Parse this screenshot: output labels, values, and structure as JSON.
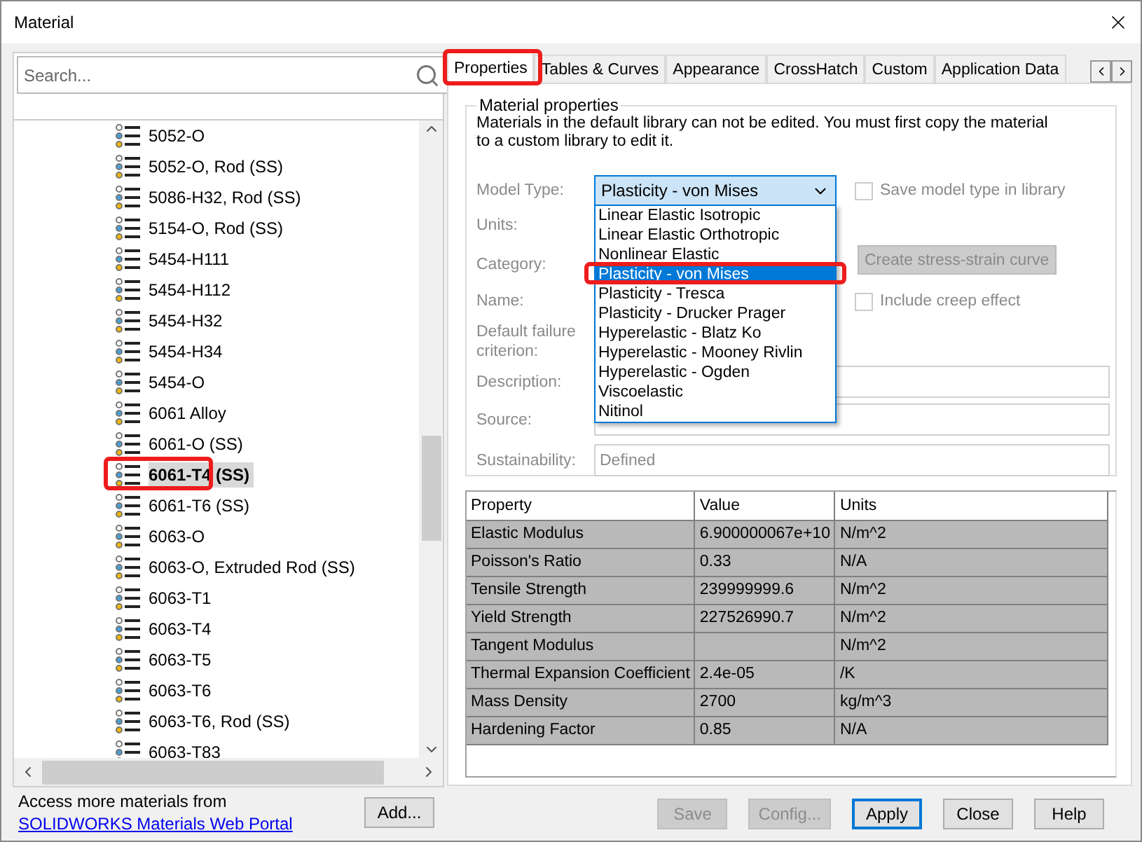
{
  "window": {
    "title": "Material"
  },
  "search": {
    "placeholder": "Search..."
  },
  "tree_items": [
    {
      "label": "5052-O",
      "selected": false,
      "annotated": false
    },
    {
      "label": "5052-O, Rod (SS)",
      "selected": false,
      "annotated": false
    },
    {
      "label": "5086-H32, Rod (SS)",
      "selected": false,
      "annotated": false
    },
    {
      "label": "5154-O, Rod (SS)",
      "selected": false,
      "annotated": false
    },
    {
      "label": "5454-H111",
      "selected": false,
      "annotated": false
    },
    {
      "label": "5454-H112",
      "selected": false,
      "annotated": false
    },
    {
      "label": "5454-H32",
      "selected": false,
      "annotated": false
    },
    {
      "label": "5454-H34",
      "selected": false,
      "annotated": false
    },
    {
      "label": "5454-O",
      "selected": false,
      "annotated": false
    },
    {
      "label": "6061 Alloy",
      "selected": false,
      "annotated": false
    },
    {
      "label": "6061-O (SS)",
      "selected": false,
      "annotated": false
    },
    {
      "label": "6061-T4 (SS)",
      "selected": true,
      "annotated": true
    },
    {
      "label": "6061-T6 (SS)",
      "selected": false,
      "annotated": false
    },
    {
      "label": "6063-O",
      "selected": false,
      "annotated": false
    },
    {
      "label": "6063-O, Extruded Rod (SS)",
      "selected": false,
      "annotated": false
    },
    {
      "label": "6063-T1",
      "selected": false,
      "annotated": false
    },
    {
      "label": "6063-T4",
      "selected": false,
      "annotated": false
    },
    {
      "label": "6063-T5",
      "selected": false,
      "annotated": false
    },
    {
      "label": "6063-T6",
      "selected": false,
      "annotated": false
    },
    {
      "label": "6063-T6, Rod (SS)",
      "selected": false,
      "annotated": false
    },
    {
      "label": "6063-T83",
      "selected": false,
      "annotated": false
    }
  ],
  "footer": {
    "text": "Access more materials from",
    "link": "SOLIDWORKS Materials Web Portal",
    "add_button": "Add..."
  },
  "tabs": [
    {
      "label": "Properties",
      "selected": true,
      "annotated": true
    },
    {
      "label": "Tables & Curves",
      "selected": false,
      "annotated": false
    },
    {
      "label": "Appearance",
      "selected": false,
      "annotated": false
    },
    {
      "label": "CrossHatch",
      "selected": false,
      "annotated": false
    },
    {
      "label": "Custom",
      "selected": false,
      "annotated": false
    },
    {
      "label": "Application Data",
      "selected": false,
      "annotated": false
    }
  ],
  "group": {
    "title": "Material properties",
    "note": "Materials in the default library can not be edited. You must first copy the material to a custom library to edit it.",
    "fields": [
      {
        "label": "Model Type:",
        "kind": "select",
        "value": "Plasticity - von Mises",
        "expanded": true
      },
      {
        "label": "Units:",
        "kind": "covered"
      },
      {
        "label": "Category:",
        "kind": "covered"
      },
      {
        "label": "Name:",
        "kind": "covered"
      },
      {
        "label": "Default failure criterion:",
        "kind": "covered"
      },
      {
        "label": "Description:",
        "kind": "text"
      },
      {
        "label": "Source:",
        "kind": "text"
      },
      {
        "label": "Sustainability:",
        "kind": "text",
        "value": "Defined"
      }
    ],
    "options": [
      {
        "label": "Linear Elastic Isotropic",
        "selected": false,
        "annotated": false
      },
      {
        "label": "Linear Elastic Orthotropic",
        "selected": false,
        "annotated": false
      },
      {
        "label": "Nonlinear Elastic",
        "selected": false,
        "annotated": false
      },
      {
        "label": "Plasticity - von Mises",
        "selected": true,
        "annotated": true
      },
      {
        "label": "Plasticity - Tresca",
        "selected": false,
        "annotated": false
      },
      {
        "label": "Plasticity - Drucker Prager",
        "selected": false,
        "annotated": false
      },
      {
        "label": "Hyperelastic - Blatz Ko",
        "selected": false,
        "annotated": false
      },
      {
        "label": "Hyperelastic - Mooney Rivlin",
        "selected": false,
        "annotated": false
      },
      {
        "label": "Hyperelastic - Ogden",
        "selected": false,
        "annotated": false
      },
      {
        "label": "Viscoelastic",
        "selected": false,
        "annotated": false
      },
      {
        "label": "Nitinol",
        "selected": false,
        "annotated": false
      }
    ],
    "save_model_type": {
      "label": "Save model type in library",
      "checked": false,
      "disabled": true
    },
    "stress_strain_button": {
      "label": "Create stress-strain curve",
      "disabled": true
    },
    "creep": {
      "label": "Include creep effect",
      "checked": false,
      "disabled": true
    }
  },
  "table": {
    "columns": [
      "Property",
      "Value",
      "Units"
    ],
    "rows": [
      [
        "Elastic Modulus",
        "6.900000067e+10",
        "N/m^2"
      ],
      [
        "Poisson's Ratio",
        "0.33",
        "N/A"
      ],
      [
        "Tensile Strength",
        "239999999.6",
        "N/m^2"
      ],
      [
        "Yield Strength",
        "227526990.7",
        "N/m^2"
      ],
      [
        "Tangent Modulus",
        "",
        "N/m^2"
      ],
      [
        "Thermal Expansion Coefficient",
        "2.4e-05",
        "/K"
      ],
      [
        "Mass Density",
        "2700",
        "kg/m^3"
      ],
      [
        "Hardening Factor",
        "0.85",
        "N/A"
      ]
    ]
  },
  "buttons": [
    {
      "label": "Save",
      "disabled": true,
      "default": false
    },
    {
      "label": "Config...",
      "disabled": true,
      "default": false
    },
    {
      "label": "Apply",
      "disabled": false,
      "default": true
    },
    {
      "label": "Close",
      "disabled": false,
      "default": false
    },
    {
      "label": "Help",
      "disabled": false,
      "default": false
    }
  ]
}
